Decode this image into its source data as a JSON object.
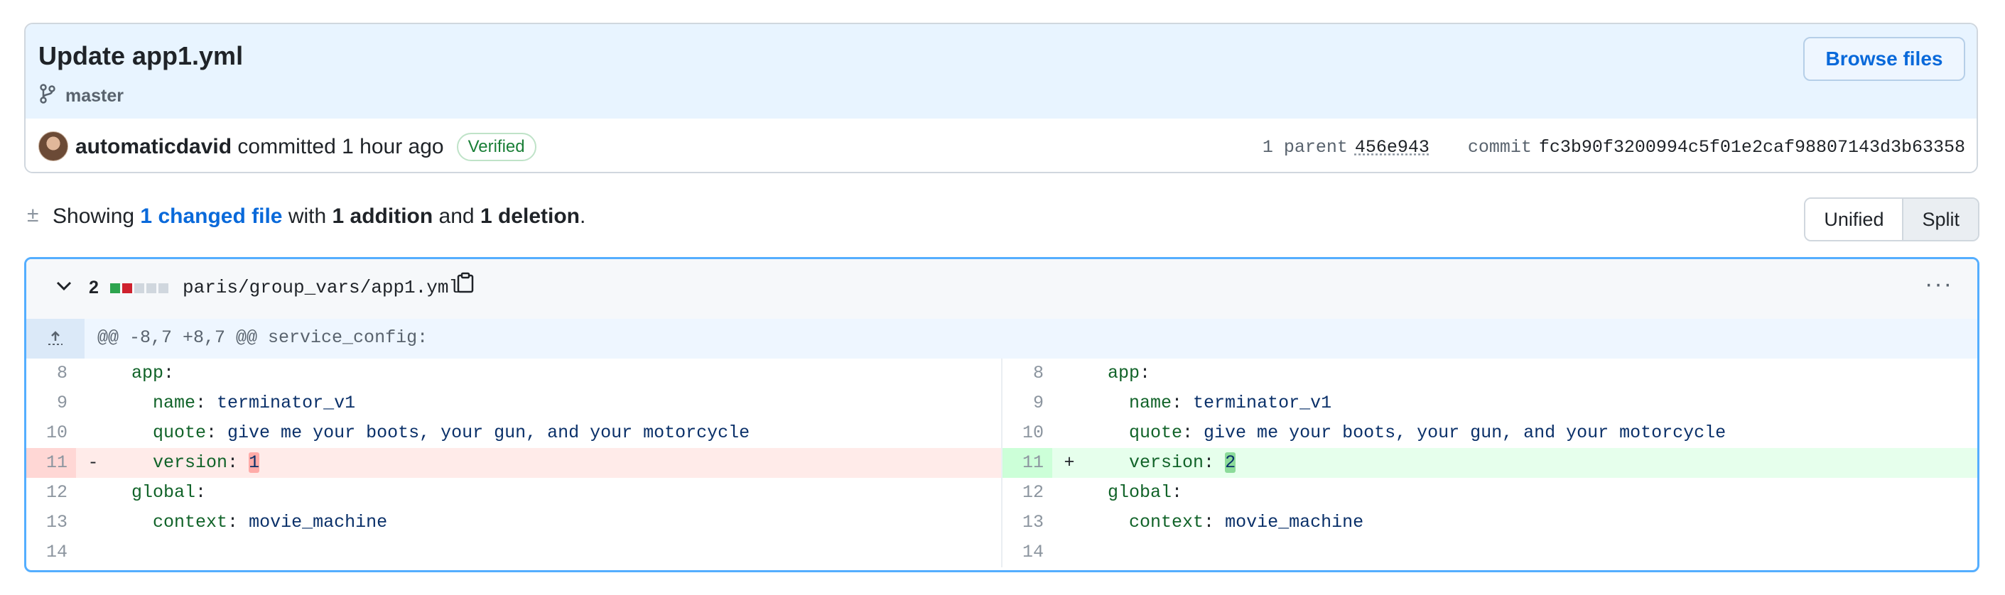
{
  "commit": {
    "title": "Update app1.yml",
    "branch": "master",
    "browse_label": "Browse files",
    "author": "automaticdavid",
    "action": "committed",
    "time": "1 hour ago",
    "verified": "Verified",
    "parent_label": "1 parent",
    "parent_hash": "456e943",
    "commit_label": "commit",
    "commit_hash": "fc3b90f3200994c5f01e2caf98807143d3b63358"
  },
  "summary": {
    "prefix": "Showing",
    "changed": "1 changed file",
    "with": "with",
    "additions": "1 addition",
    "and": "and",
    "deletions": "1 deletion",
    "suffix": "."
  },
  "view_toggle": {
    "unified": "Unified",
    "split": "Split",
    "selected": "Split"
  },
  "file": {
    "change_count": "2",
    "path": "paris/group_vars/app1.yml",
    "hunk_header": "@@ -8,7 +8,7 @@ service_config:",
    "blocks": [
      "#2da44e",
      "#cf222e",
      "#d0d7de",
      "#d0d7de",
      "#d0d7de"
    ]
  },
  "diff_rows": [
    {
      "l_num": "8",
      "l_key": "app",
      "l_val": "",
      "indent": "  ",
      "r_num": "8",
      "r_key": "app",
      "r_val": ""
    },
    {
      "l_num": "9",
      "l_key": "name",
      "l_val": " terminator_v1",
      "indent": "    ",
      "r_num": "9",
      "r_key": "name",
      "r_val": " terminator_v1"
    },
    {
      "l_num": "10",
      "l_key": "quote",
      "l_val": " give me your boots, your gun, and your motorcycle",
      "indent": "    ",
      "r_num": "10",
      "r_key": "quote",
      "r_val": " give me your boots, your gun, and your motorcycle"
    },
    {
      "l_num": "11",
      "l_key": "version",
      "l_val": "1",
      "indent": "    ",
      "r_num": "11",
      "r_key": "version",
      "r_val": "2",
      "changed": true,
      "l_sign": "-",
      "r_sign": "+"
    },
    {
      "l_num": "12",
      "l_key": "global",
      "l_val": "",
      "indent": "  ",
      "r_num": "12",
      "r_key": "global",
      "r_val": ""
    },
    {
      "l_num": "13",
      "l_key": "context",
      "l_val": " movie_machine",
      "indent": "    ",
      "r_num": "13",
      "r_key": "context",
      "r_val": " movie_machine"
    },
    {
      "l_num": "14",
      "l_key": "",
      "l_val": "",
      "indent": "",
      "r_num": "14",
      "r_key": "",
      "r_val": ""
    }
  ]
}
